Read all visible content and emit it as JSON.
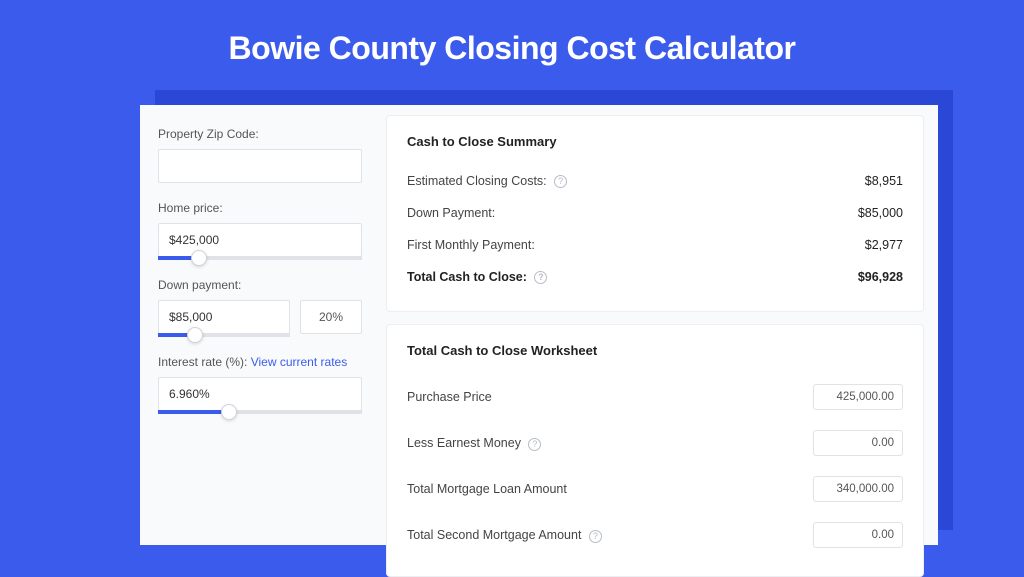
{
  "page_title": "Bowie County Closing Cost Calculator",
  "left_panel": {
    "zip_label": "Property Zip Code:",
    "zip_value": "",
    "home_price_label": "Home price:",
    "home_price_value": "$425,000",
    "home_price_slider_pct": 20,
    "down_payment_label": "Down payment:",
    "down_payment_value": "$85,000",
    "down_payment_pct_value": "20%",
    "down_payment_slider_pct": 28,
    "interest_label": "Interest rate (%):",
    "interest_link": "View current rates",
    "interest_value": "6.960%",
    "interest_slider_pct": 35
  },
  "summary": {
    "title": "Cash to Close Summary",
    "rows": [
      {
        "label": "Estimated Closing Costs:",
        "help": true,
        "value": "$8,951"
      },
      {
        "label": "Down Payment:",
        "help": false,
        "value": "$85,000"
      },
      {
        "label": "First Monthly Payment:",
        "help": false,
        "value": "$2,977"
      }
    ],
    "total": {
      "label": "Total Cash to Close:",
      "help": true,
      "value": "$96,928"
    }
  },
  "worksheet": {
    "title": "Total Cash to Close Worksheet",
    "rows": [
      {
        "label": "Purchase Price",
        "help": false,
        "value": "425,000.00"
      },
      {
        "label": "Less Earnest Money",
        "help": true,
        "value": "0.00"
      },
      {
        "label": "Total Mortgage Loan Amount",
        "help": false,
        "value": "340,000.00"
      },
      {
        "label": "Total Second Mortgage Amount",
        "help": true,
        "value": "0.00"
      }
    ]
  }
}
